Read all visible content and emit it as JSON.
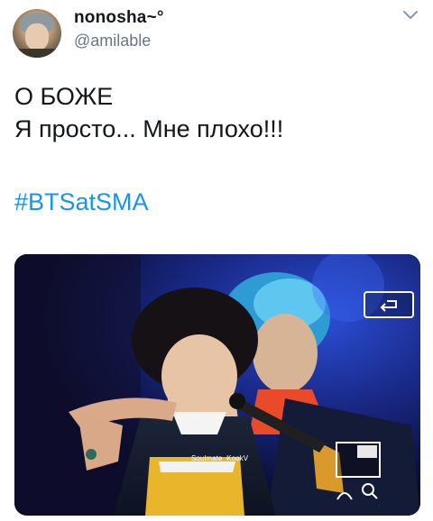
{
  "tweet": {
    "display_name": "nonosha~°",
    "username": "@amilable",
    "text_lines": [
      "О БОЖЕ",
      "Я просто... Мне плохо!!!"
    ],
    "hashtag": "#BTSatSMA"
  },
  "media": {
    "watermark": "Soulmate_KookV"
  },
  "icons": {
    "menu": "chevron-down-icon",
    "back": "return-arrow-icon",
    "zoom": "magnifier-icon"
  },
  "colors": {
    "name": "#14171a",
    "handle": "#657786",
    "hashtag": "#1b95e0"
  }
}
